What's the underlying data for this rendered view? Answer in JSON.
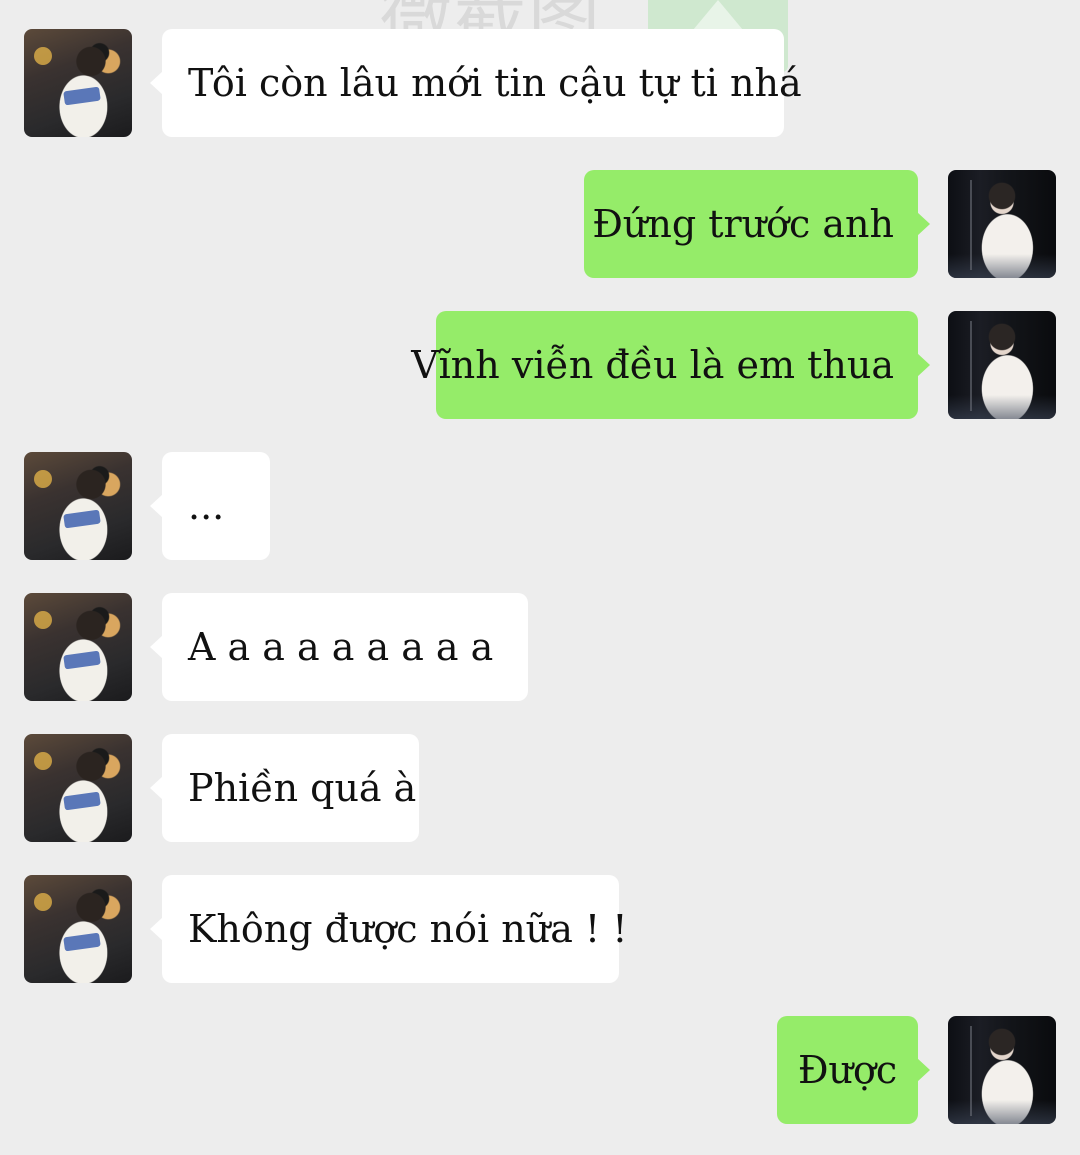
{
  "watermark": {
    "text": "微截图"
  },
  "messages": [
    {
      "side": "left",
      "text": "Tôi còn lâu mới tin cậu tự  ti nhá"
    },
    {
      "side": "right",
      "text": "Đứng trước anh"
    },
    {
      "side": "right",
      "text": "Vĩnh viễn đều là em thua"
    },
    {
      "side": "left",
      "text": "..."
    },
    {
      "side": "left",
      "text": "A a a a a a a a a"
    },
    {
      "side": "left",
      "text": "Phiền quá à"
    },
    {
      "side": "left",
      "text": "Không được nói nữa !  !"
    },
    {
      "side": "right",
      "text": "Được"
    }
  ],
  "colors": {
    "background": "#ededed",
    "incoming_bubble": "#ffffff",
    "outgoing_bubble": "#95ec69"
  }
}
